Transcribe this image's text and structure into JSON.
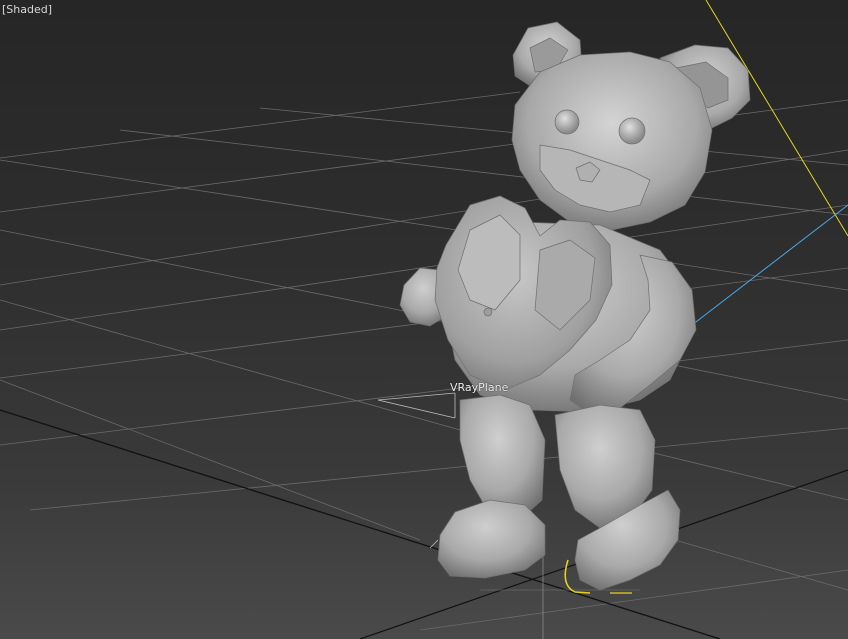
{
  "viewport": {
    "label": "[Shaded]",
    "background": "#2e2e2e",
    "grid_color": "#6a6a6a",
    "selection_color": "#e6d21e",
    "axis_color": "#4aa8e8"
  },
  "scene": {
    "object_label": "VRayPlane",
    "object_icon": "teddy-bear-model"
  }
}
